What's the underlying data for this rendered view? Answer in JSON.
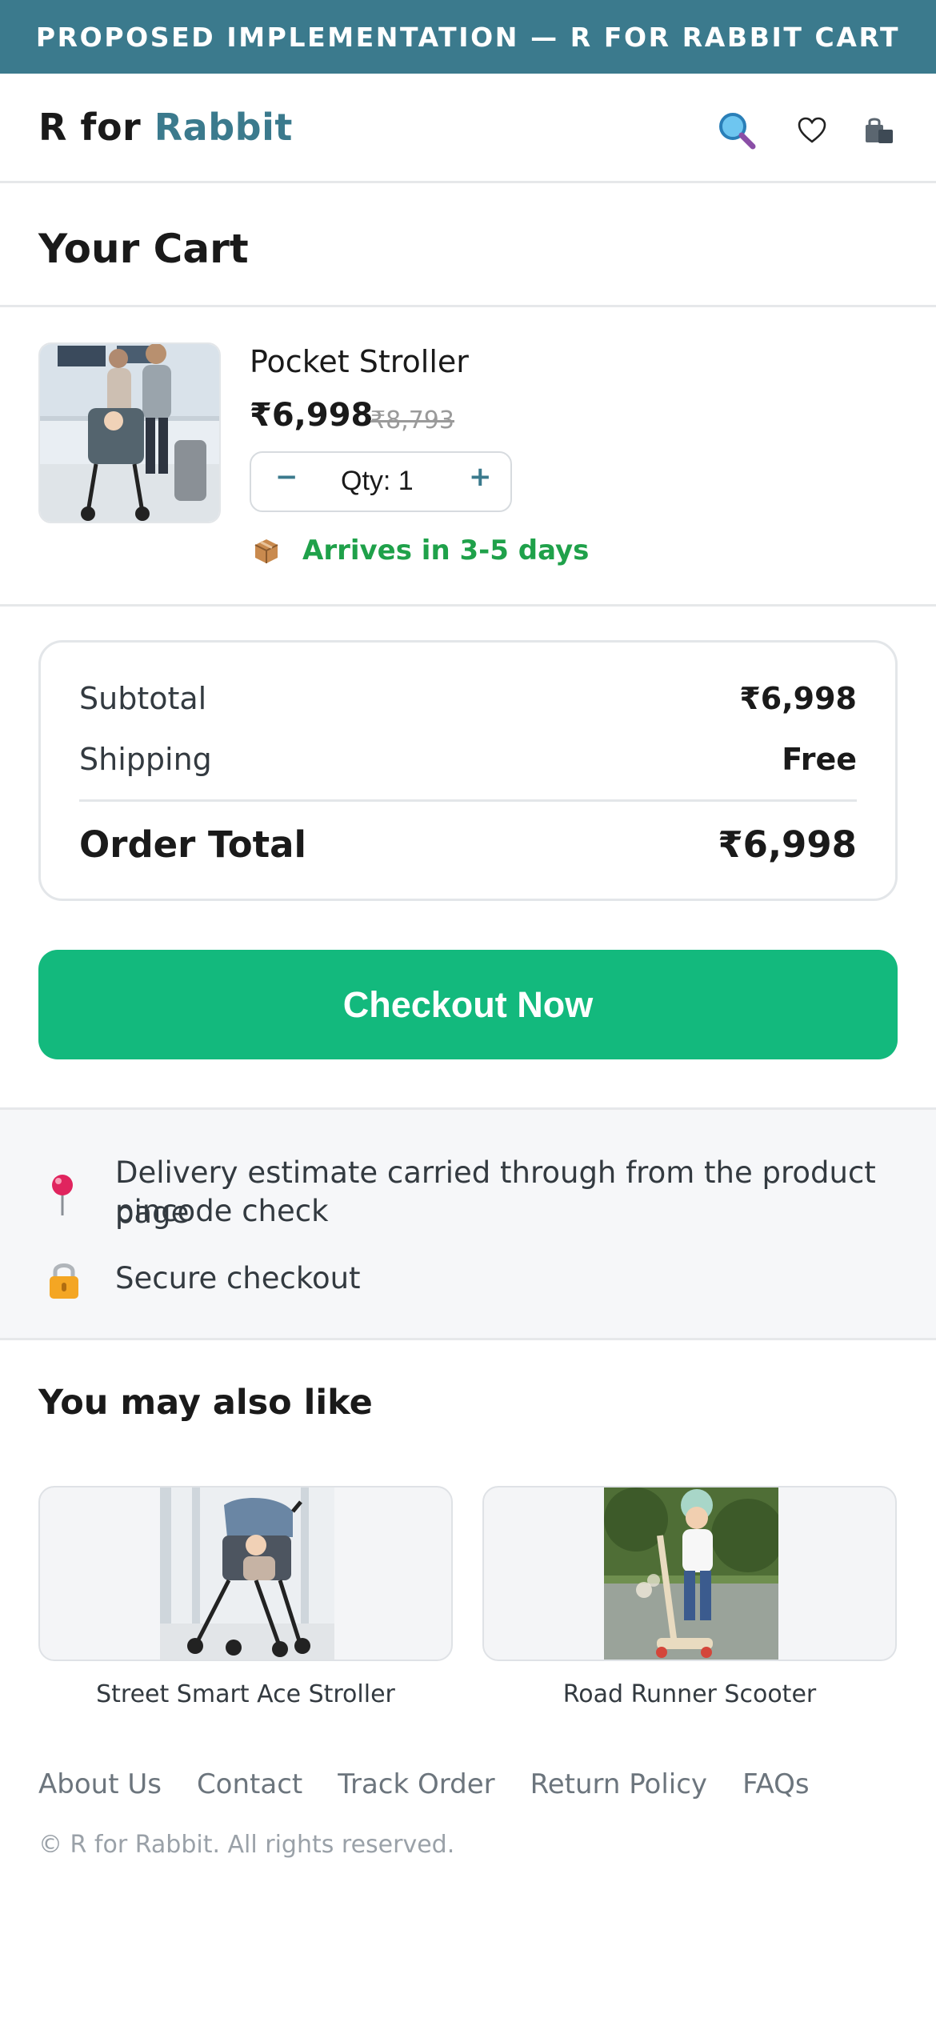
{
  "banner": {
    "text": "PROPOSED IMPLEMENTATION — R FOR RABBIT CART"
  },
  "header": {
    "brand_part1": "R for",
    "brand_part2": "Rabbit",
    "icons": [
      "search-icon",
      "heart-icon",
      "shopping-bag-icon"
    ],
    "brand_color": "#3b7a8d"
  },
  "cart": {
    "title": "Your Cart",
    "item": {
      "name": "Pocket Stroller",
      "price": "₹6,998",
      "original_price": "₹8,793",
      "qty_label": "Qty: 1",
      "minus": "−",
      "plus": "+",
      "arrival": "Arrives in 3-5 days",
      "image": "stroller-family-photo"
    }
  },
  "summary": {
    "subtotal_label": "Subtotal",
    "subtotal_value": "₹6,998",
    "shipping_label": "Shipping",
    "shipping_value": "Free",
    "total_label": "Order Total",
    "total_value": "₹6,998"
  },
  "checkout": {
    "label": "Checkout Now",
    "color": "#13b97d"
  },
  "info": {
    "delivery_line1": "Delivery estimate carried through from the product page",
    "delivery_line2": "pincode check",
    "secure": "Secure checkout"
  },
  "recommendations": {
    "title": "You may also like",
    "items": [
      {
        "name": "Street Smart Ace Stroller",
        "image": "stroller-photo"
      },
      {
        "name": "Road Runner Scooter",
        "image": "kid-scooter-photo"
      }
    ]
  },
  "footer": {
    "links": [
      "About Us",
      "Contact",
      "Track Order",
      "Return Policy",
      "FAQs"
    ],
    "copyright": "© R for Rabbit. All rights reserved."
  }
}
